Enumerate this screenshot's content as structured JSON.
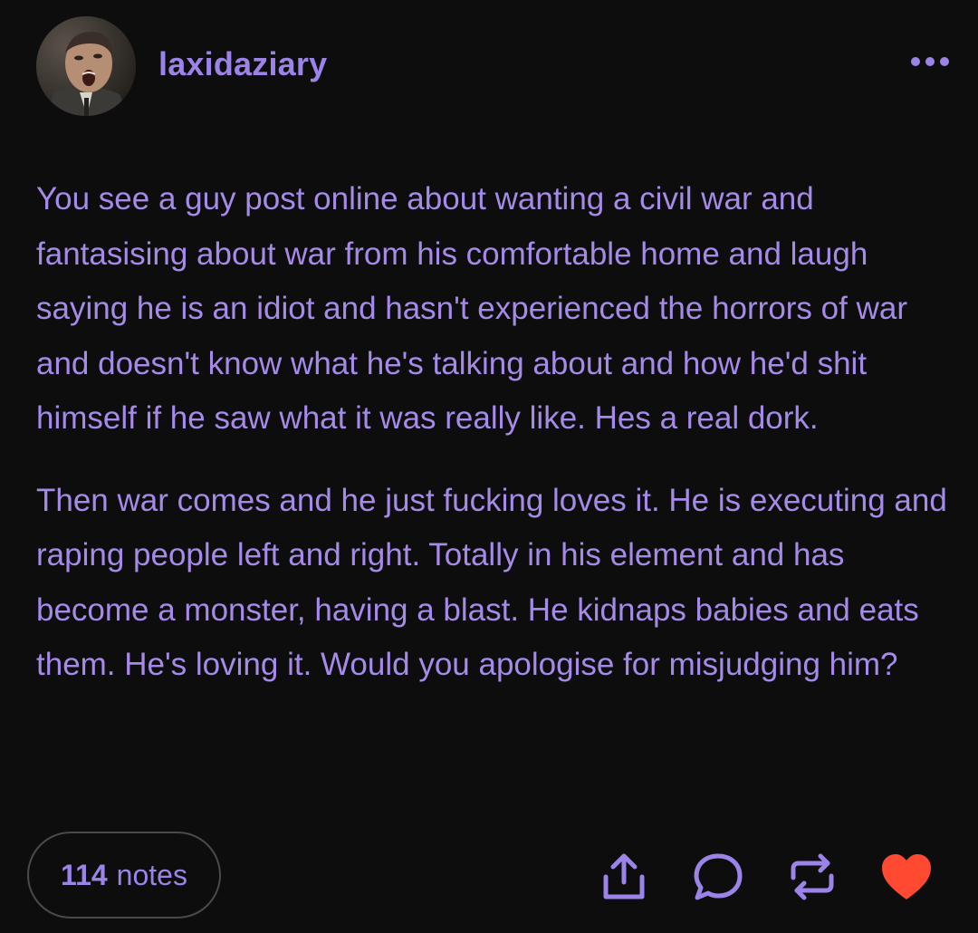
{
  "post": {
    "username": "laxidaziary",
    "paragraphs": [
      "You see a guy post online about wanting a civil war and fantasising about war from his comfortable home and laugh saying he is an idiot and hasn't experienced the horrors of war and doesn't know what he's talking about and how he'd shit himself if he saw what it was really like. Hes a real dork.",
      "Then war comes and he just fucking loves it. He is executing and raping people left and right. Totally in his element and has become a monster, having a blast. He kidnaps babies and eats them. He's loving it. Would you apologise for misjudging him?"
    ],
    "notes_count": "114",
    "notes_label": "notes"
  },
  "icons": {
    "more": "more-dots-icon",
    "share": "share-icon",
    "reply": "reply-bubble-icon",
    "reblog": "reblog-icon",
    "like": "heart-icon"
  },
  "colors": {
    "background": "#0d0d0e",
    "accent": "#9c83e8",
    "text": "#a58ae8",
    "like": "#ff4930"
  }
}
